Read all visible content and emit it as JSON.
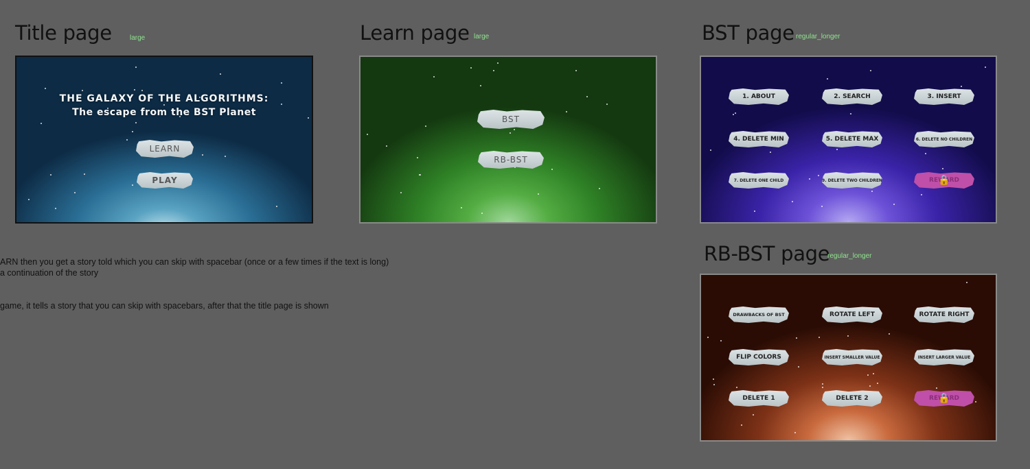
{
  "sections": {
    "title": {
      "heading": "Title page",
      "tag": "large"
    },
    "learn": {
      "heading": "Learn page",
      "tag": "large"
    },
    "bst": {
      "heading": "BST page",
      "tag": "regular_longer"
    },
    "rbbst": {
      "heading": "RB-BST page",
      "tag": "regular_longer"
    }
  },
  "title_screen": {
    "title_line1": "THE GALAXY OF THE ALGORITHMS:",
    "title_line2": "The escape from the BST Planet",
    "learn_label": "LEARN",
    "play_label": "PLAY"
  },
  "learn_screen": {
    "bst_label": "BST",
    "rbbst_label": "RB-BST"
  },
  "bst_screen": {
    "buttons": [
      "1. ABOUT",
      "2. SEARCH",
      "3. INSERT",
      "4. DELETE MIN",
      "5. DELETE MAX",
      "6. DELETE NO CHILDREN",
      "7. DELETE ONE CHILD",
      "9. DELETE TWO CHILDREN",
      "REWARD"
    ]
  },
  "rbbst_screen": {
    "buttons": [
      "DRAWBACKS OF BST",
      "ROTATE LEFT",
      "ROTATE RIGHT",
      "FLIP COLORS",
      "INSERT SMALLER VALUE",
      "INSERT LARGER VALUE",
      "DELETE 1",
      "DELETE 2",
      "REWARD"
    ]
  },
  "notes": {
    "line1": "ARN then you get a story told  which you can skip with spacebar (once or a few times if the text is long)",
    "line2": "a continuation  of the story",
    "line3": "game, it tells a story that you can skip with spacebars, after that the title page is shown"
  },
  "icons": {
    "lock": "lock-icon"
  },
  "colors": {
    "canvas": "#5f5f5f",
    "tag": "#8fe58f",
    "locked_button": "#bf4fa8",
    "glow": "#fff6a0"
  }
}
